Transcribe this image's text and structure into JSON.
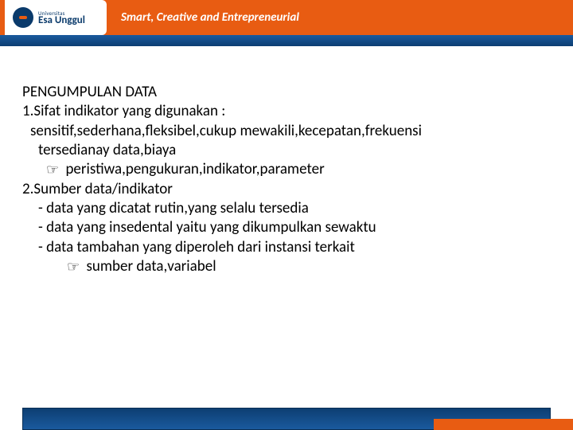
{
  "header": {
    "logo_uni": "Universitas",
    "logo_name": "Esa Unggul",
    "tagline": "Smart, Creative and Entrepreneurial"
  },
  "content": {
    "title": "PENGUMPULAN DATA",
    "item1_heading": "1.Sifat indikator yang digunakan :",
    "item1_line1": "sensitif,sederhana,fleksibel,cukup mewakili,kecepatan,frekuensi",
    "item1_line2": "tersedianay data,biaya",
    "item1_note": "peristiwa,pengukuran,indikator,parameter",
    "item2_heading": "2.Sumber data/indikator",
    "item2_bullet1": "- data yang dicatat rutin,yang selalu tersedia",
    "item2_bullet2": "- data yang insedental yaitu yang dikumpulkan sewaktu",
    "item2_bullet3": "- data tambahan yang diperoleh dari instansi terkait",
    "item2_note": "sumber data,variabel"
  }
}
